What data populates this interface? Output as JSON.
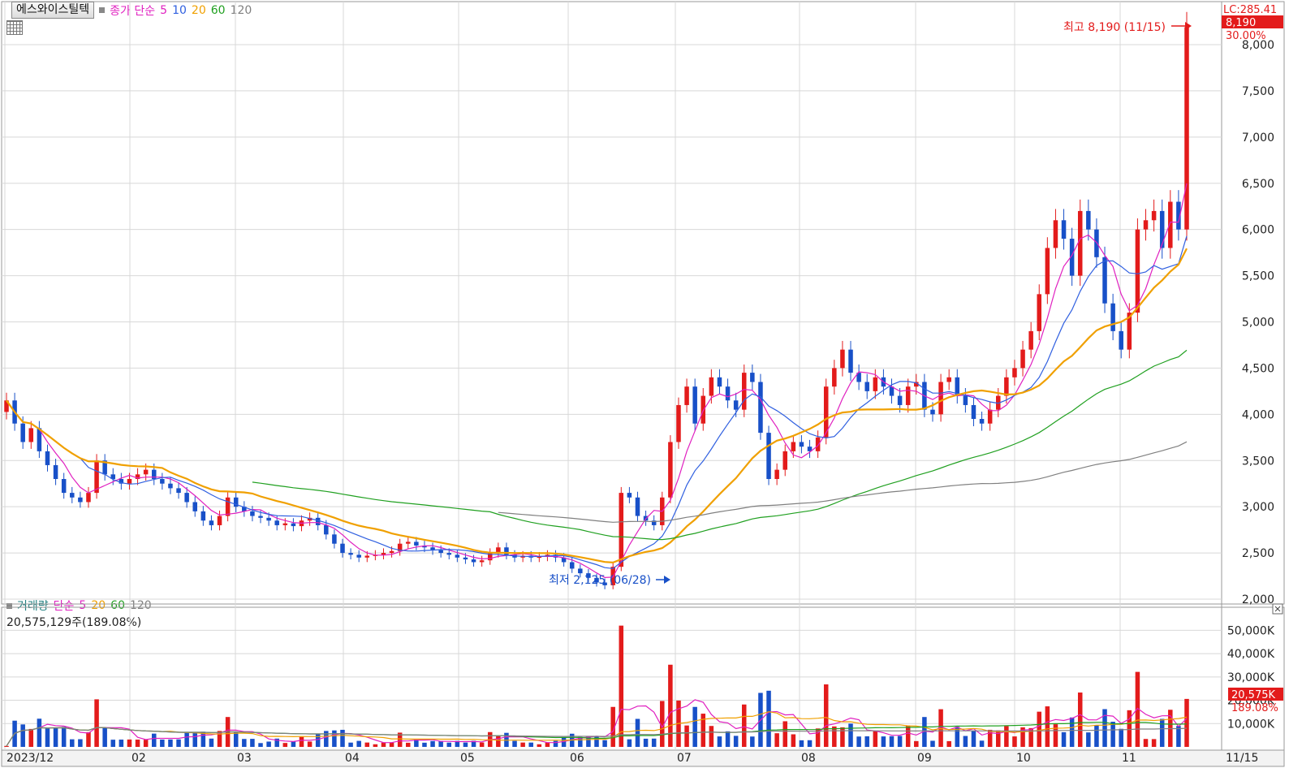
{
  "legend": {
    "stock_name": "에스와이스틸텍",
    "series_label": "종가 단순",
    "ma_periods": [
      "5",
      "10",
      "20",
      "60",
      "120"
    ],
    "ma_colors": [
      "#e020c0",
      "#3060e0",
      "#f0a000",
      "#20a020",
      "#808080"
    ]
  },
  "price_panel": {
    "lc_label": "LC:285.41",
    "last_price_tag": "8,190",
    "change_pct_tag": "30.00%",
    "high_annotation": "최고 8,190 (11/15)",
    "low_annotation": "최저 2,125 (06/28)"
  },
  "volume_panel": {
    "legend_label": "거래량",
    "series_label": "단순",
    "ma_periods": [
      "5",
      "20",
      "60",
      "120"
    ],
    "ma_colors": [
      "#e020c0",
      "#f0a000",
      "#20a020",
      "#808080"
    ],
    "summary": "20,575,129주(189.08%)",
    "last_volume_tag": "20,575K",
    "last_ratio_tag": "189.08%"
  },
  "colors": {
    "up": "#e31b1b",
    "down": "#1850c8",
    "grid": "#d8d8d8"
  },
  "chart_data": [
    {
      "type": "candlestick",
      "title": "에스와이스틸텍",
      "x_axis_labels": [
        "2023/12",
        "02",
        "03",
        "04",
        "05",
        "06",
        "07",
        "08",
        "09",
        "10",
        "11",
        "11/15"
      ],
      "y_ticks": [
        "2,000",
        "2,500",
        "3,000",
        "3,500",
        "4,000",
        "4,500",
        "5,000",
        "5,500",
        "6,000",
        "6,500",
        "7,000",
        "7,500",
        "8,000"
      ],
      "ylim": [
        2000,
        8000
      ],
      "high": {
        "value": 8190,
        "date": "11/15"
      },
      "low": {
        "value": 2125,
        "date": "06/28"
      },
      "close_series": [
        {
          "month": "2023/12",
          "values": [
            4150,
            3900,
            3700,
            3850,
            3600,
            3450,
            3300,
            3150,
            3100,
            3050,
            3150
          ]
        },
        {
          "month": "02",
          "values": [
            3500,
            3350,
            3300,
            3250,
            3300,
            3350,
            3400,
            3300,
            3250,
            3200,
            3150,
            3050,
            2950,
            2850,
            2800,
            2900,
            3100,
            3000
          ]
        },
        {
          "month": "03",
          "values": [
            2950,
            2900,
            2880,
            2850,
            2800,
            2820,
            2790,
            2850,
            2880,
            2800,
            2700,
            2600,
            2500,
            2480,
            2450,
            2470,
            2480,
            2500,
            2520
          ]
        },
        {
          "month": "05",
          "values": [
            2600,
            2620,
            2580,
            2560,
            2530,
            2500,
            2480,
            2450,
            2430,
            2400,
            2420,
            2500,
            2560,
            2480,
            2450,
            2470,
            2450,
            2460
          ]
        },
        {
          "month": "06",
          "values": [
            2480,
            2450,
            2400,
            2330,
            2280,
            2230,
            2180,
            2150
          ]
        },
        {
          "month": "07",
          "values": [
            2350,
            3150,
            3100,
            2900,
            2850,
            2800,
            3100,
            3700,
            4100,
            4300,
            3900,
            4200,
            4400,
            4300,
            4150,
            4050,
            4450,
            4350,
            3800,
            3300,
            3400,
            3600,
            3700,
            3650,
            3600,
            3750,
            4300,
            4500,
            4700,
            4450,
            4350
          ]
        },
        {
          "month": "09",
          "values": [
            4250,
            4400,
            4300,
            4200,
            4100,
            4300,
            4350,
            4050,
            4000,
            4350,
            4400,
            4200,
            4100,
            3950,
            3900,
            4050,
            4200,
            4400,
            4500,
            4700,
            4900,
            5300,
            5800,
            6100,
            5900,
            5500,
            6200,
            6000,
            5700,
            5200,
            4900,
            4700,
            5100,
            6000,
            6100,
            6200,
            5800,
            6300,
            6000
          ]
        },
        {
          "month": "11",
          "values": [
            8190
          ]
        }
      ]
    },
    {
      "type": "bar",
      "title": "거래량",
      "unit": "K",
      "y_ticks": [
        "10,000K",
        "20,000K",
        "30,000K",
        "40,000K",
        "50,000K"
      ],
      "ylim": [
        0,
        55000
      ],
      "last_volume": 20575
    }
  ]
}
